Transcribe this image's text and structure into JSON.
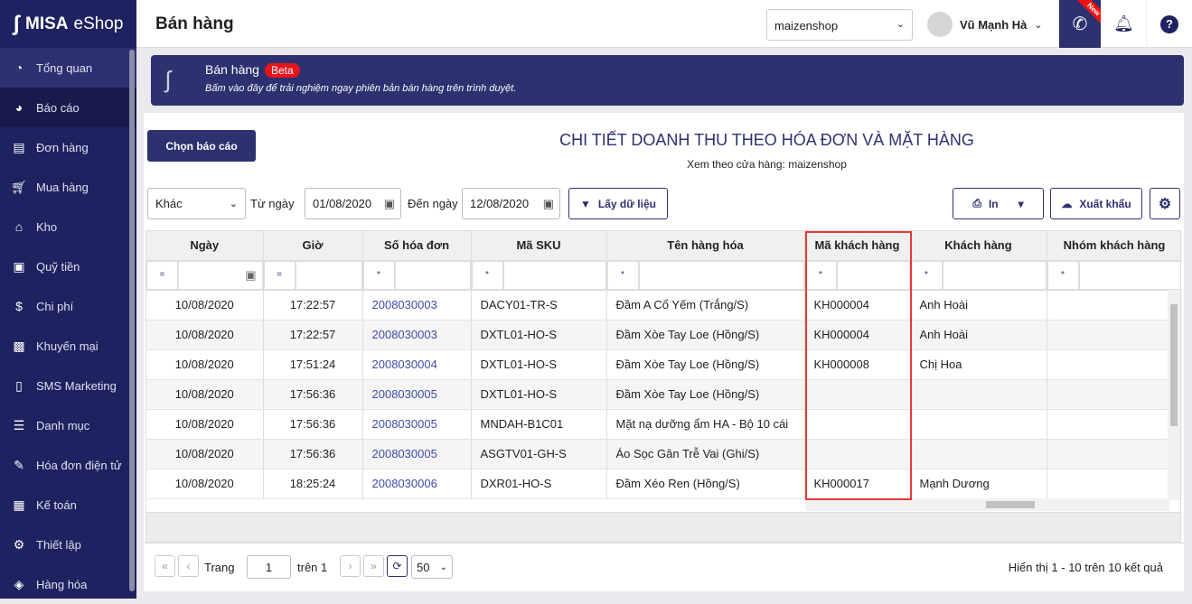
{
  "brand": {
    "name_bold": "MISA",
    "name_light": "eShop"
  },
  "sidebar": {
    "items": [
      {
        "label": "Tổng quan",
        "icon": "dashboard-icon"
      },
      {
        "label": "Báo cáo",
        "icon": "pie-chart-icon"
      },
      {
        "label": "Đơn hàng",
        "icon": "order-icon"
      },
      {
        "label": "Mua hàng",
        "icon": "cart-icon"
      },
      {
        "label": "Kho",
        "icon": "warehouse-icon"
      },
      {
        "label": "Quỹ tiền",
        "icon": "safe-icon"
      },
      {
        "label": "Chi phí",
        "icon": "money-icon"
      },
      {
        "label": "Khuyến mại",
        "icon": "gift-icon"
      },
      {
        "label": "SMS Marketing",
        "icon": "phone-icon"
      },
      {
        "label": "Danh mục",
        "icon": "list-icon"
      },
      {
        "label": "Hóa đơn điện tử",
        "icon": "invoice-icon"
      },
      {
        "label": "Kế toán",
        "icon": "calculator-icon"
      },
      {
        "label": "Thiết lập",
        "icon": "gear-icon"
      },
      {
        "label": "Hàng hóa",
        "icon": "goods-icon"
      }
    ]
  },
  "header": {
    "title": "Bán hàng",
    "shop": "maizenshop",
    "user": "Vũ Mạnh Hà",
    "new_badge": "New",
    "help": "?"
  },
  "banner": {
    "title": "Bán hàng",
    "badge": "Beta",
    "subtitle": "Bấm vào đây để trải nghiệm ngay phiên bản bán hàng trên trình duyệt."
  },
  "report": {
    "choose_button": "Chọn báo cáo",
    "title": "CHI TIẾT DOANH THU THEO HÓA ĐƠN VÀ MẶT HÀNG",
    "subtitle": "Xem theo cửa hàng: maizenshop"
  },
  "filters": {
    "period": "Khác",
    "from_label": "Từ ngày",
    "from": "01/08/2020",
    "to_label": "Đến ngày",
    "to": "12/08/2020",
    "fetch": "Lấy dữ liệu",
    "print": "In",
    "export": "Xuất khẩu"
  },
  "table": {
    "columns": [
      "Ngày",
      "Giờ",
      "Số hóa đơn",
      "Mã SKU",
      "Tên hàng hóa",
      "Mã khách hàng",
      "Khách hàng",
      "Nhóm khách hàng"
    ],
    "filter_ops": [
      "=",
      "=",
      "*",
      "*",
      "*",
      "*",
      "*",
      "*"
    ],
    "rows": [
      [
        "10/08/2020",
        "17:22:57",
        "2008030003",
        "DACY01-TR-S",
        "Đầm A Cổ Yếm (Trắng/S)",
        "KH000004",
        "Anh Hoài",
        ""
      ],
      [
        "10/08/2020",
        "17:22:57",
        "2008030003",
        "DXTL01-HO-S",
        "Đầm Xòe Tay Loe (Hồng/S)",
        "KH000004",
        "Anh Hoài",
        ""
      ],
      [
        "10/08/2020",
        "17:51:24",
        "2008030004",
        "DXTL01-HO-S",
        "Đầm Xòe Tay Loe (Hồng/S)",
        "KH000008",
        "Chị Hoa",
        ""
      ],
      [
        "10/08/2020",
        "17:56:36",
        "2008030005",
        "DXTL01-HO-S",
        "Đầm Xòe Tay Loe (Hồng/S)",
        "",
        "",
        ""
      ],
      [
        "10/08/2020",
        "17:56:36",
        "2008030005",
        "MNDAH-B1C01",
        "Mặt nạ dưỡng ẩm HA - Bộ 10 cái",
        "",
        "",
        ""
      ],
      [
        "10/08/2020",
        "17:56:36",
        "2008030005",
        "ASGTV01-GH-S",
        "Áo Sọc Gân Trễ Vai (Ghi/S)",
        "",
        "",
        ""
      ],
      [
        "10/08/2020",
        "18:25:24",
        "2008030006",
        "DXR01-HO-S",
        "Đầm Xéo Ren (Hồng/S)",
        "KH000017",
        "Mạnh Dương",
        ""
      ]
    ]
  },
  "pager": {
    "page_label": "Trang",
    "page": "1",
    "of_label": "trên 1",
    "page_size": "50",
    "summary": "Hiển thị 1 - 10 trên 10 kết quả"
  }
}
